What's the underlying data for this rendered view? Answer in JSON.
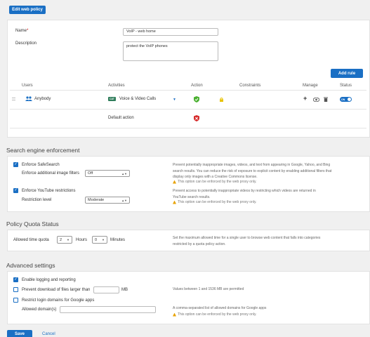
{
  "header": {
    "edit_button": "Edit web policy"
  },
  "form": {
    "name_label": "Name",
    "required_mark": "*",
    "name_value": "VoIP - web home",
    "description_label": "Description",
    "description_value": "protect the VoIP phones",
    "add_rule_button": "Add rule"
  },
  "rules_table": {
    "headers": {
      "users": "Users",
      "activities": "Activities",
      "action": "Action",
      "constraints": "Constraints",
      "manage": "Manage",
      "status": "Status"
    },
    "row": {
      "user": "Anybody",
      "activity_badge": "CAT",
      "activity": "Voice & Video Calls",
      "status": "ON"
    },
    "default_action_label": "Default action"
  },
  "search_enforcement": {
    "title": "Search engine enforcement",
    "safesearch_label": "Enforce SafeSearch",
    "image_filters_label": "Enforce additional image filters",
    "image_filters_value": "Off",
    "safesearch_hint": "Prevent potentially inappropriate images, videos, and text from appearing in Google, Yahoo, and Bing search results. You can reduce the risk of exposure to explicit content by enabling additional filters that display only images with a Creative Commons license.",
    "safesearch_warn": "This option can be enforced by the web proxy only.",
    "youtube_label": "Enforce YouTube restrictions",
    "restriction_label": "Restriction level",
    "restriction_value": "Moderate",
    "youtube_hint": "Prevent access to potentially inappropriate videos by restricting which videos are returned in YouTube search results.",
    "youtube_warn": "This option can be enforced by the web proxy only."
  },
  "quota": {
    "title": "Policy Quota Status",
    "allowed_label": "Allowed time quota",
    "hours_value": "2",
    "hours_label": "Hours",
    "minutes_value": "0",
    "minutes_label": "Minutes",
    "hint": "Set the maximum allowed time for a single user to browse web content that falls into categories restricted by a quota policy action."
  },
  "advanced": {
    "title": "Advanced settings",
    "logging_label": "Enable logging and reporting",
    "prevent_download_label": "Prevent download of files larger than",
    "mb_label": "MB",
    "mb_hint": "Values between 1 and 1536 MB are permitted",
    "restrict_login_label": "Restrict login domains for Google apps",
    "allowed_domains_label": "Allowed domain(s)",
    "domains_hint": "A comma-separated list of allowed domains for Google apps",
    "domains_warn": "This option can be enforced by the web proxy only."
  },
  "footer": {
    "save_button": "Save",
    "cancel_link": "Cancel"
  }
}
